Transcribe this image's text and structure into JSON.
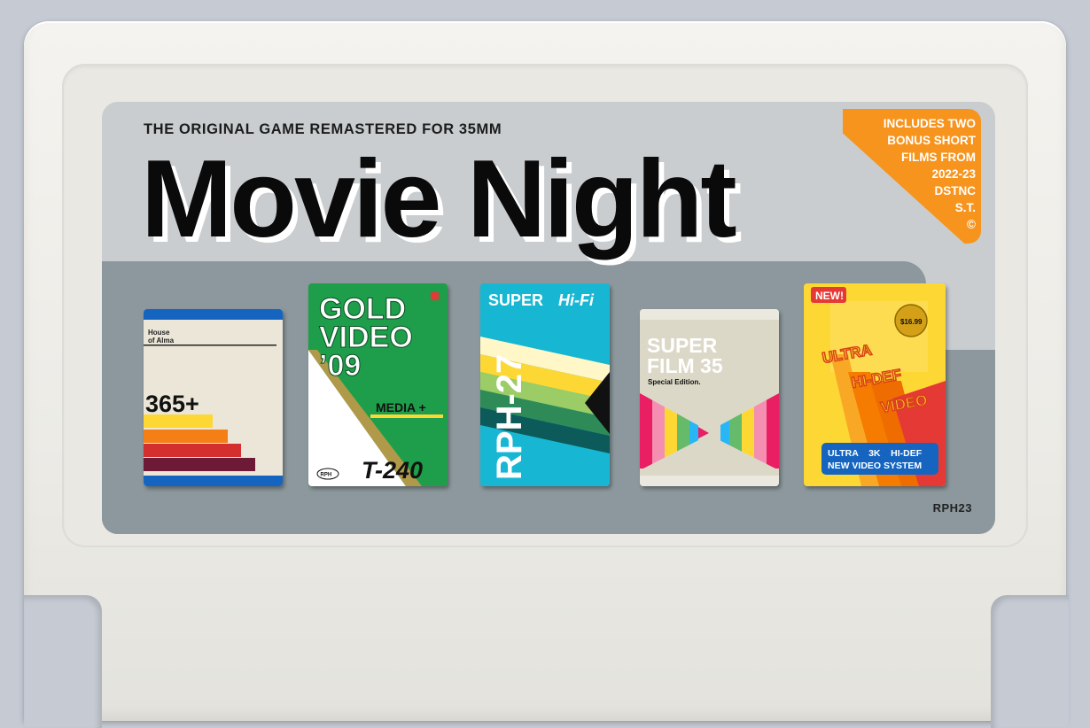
{
  "cartridge": {
    "tagline": "THE ORIGINAL GAME REMASTERED FOR 35MM",
    "title": "Movie Night",
    "badge_lines": [
      "INCLUDES TWO",
      "BONUS SHORT",
      "FILMS FROM",
      "2022-23",
      "DSTNC",
      "S.T.",
      "©"
    ],
    "serial": "RPH23"
  },
  "tapes": [
    {
      "name": "house-of-alma",
      "line1": "House",
      "line2": "of Alma",
      "number": "365+"
    },
    {
      "name": "gold-video",
      "line1": "GOLD",
      "line2": "VIDEO",
      "line3": "’09",
      "tag": "MEDIA +",
      "code": "T-240",
      "logo": "RPH"
    },
    {
      "name": "super-hifi",
      "header_bold": "SUPER",
      "header_italic": "Hi-Fi",
      "code": "RPH-27"
    },
    {
      "name": "super-film",
      "line1": "SUPER",
      "line2": "FILM 35",
      "edition": "Special Edition."
    },
    {
      "name": "ultra-hidef",
      "flag": "NEW!",
      "price": "$16.99",
      "line1": "ULTRA",
      "line2": "HI-DEF",
      "line3": "VIDEO",
      "foot1": "ULTRA    3K    HI-DEF",
      "foot2": "NEW VIDEO SYSTEM"
    }
  ],
  "colors": {
    "badge": "#f7941d",
    "label": "#c9cdcf",
    "band": "#8c989d"
  }
}
